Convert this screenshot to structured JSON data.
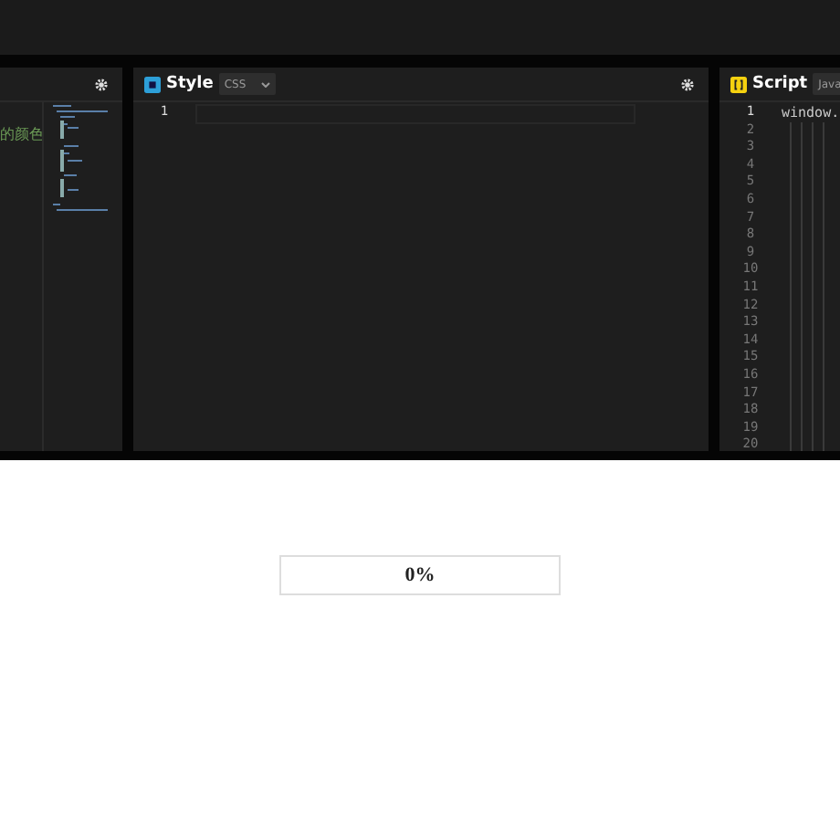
{
  "panels": [
    {
      "kind": "partial",
      "comment": "的颜色"
    },
    {
      "kind": "editor",
      "title": "Style",
      "language": "CSS",
      "line_numbers": [
        "1"
      ]
    },
    {
      "kind": "editor",
      "title": "Script",
      "language": "Java",
      "line_numbers": [
        "1",
        "2",
        "3",
        "4",
        "5",
        "6",
        "7",
        "8",
        "9",
        "10",
        "11",
        "12",
        "13",
        "14",
        "15",
        "16",
        "17",
        "18",
        "19",
        "20"
      ],
      "code": [
        "window."
      ]
    }
  ],
  "progress": {
    "label": "0%"
  }
}
